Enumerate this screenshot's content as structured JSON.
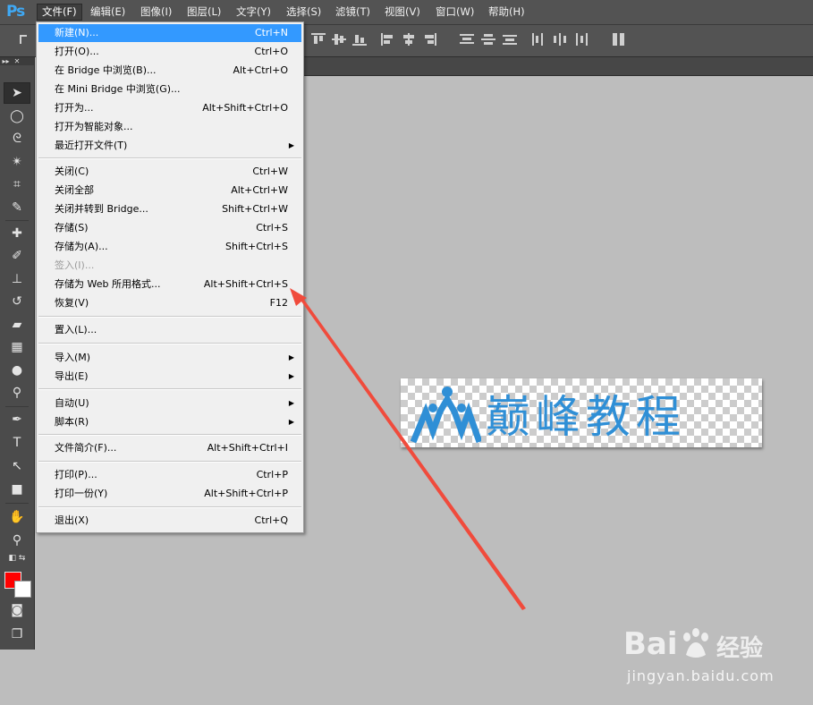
{
  "app": {
    "logo": "Ps"
  },
  "menubar": {
    "items": [
      {
        "label": "文件(F)"
      },
      {
        "label": "编辑(E)"
      },
      {
        "label": "图像(I)"
      },
      {
        "label": "图层(L)"
      },
      {
        "label": "文字(Y)"
      },
      {
        "label": "选择(S)"
      },
      {
        "label": "滤镜(T)"
      },
      {
        "label": "视图(V)"
      },
      {
        "label": "窗口(W)"
      },
      {
        "label": "帮助(H)"
      }
    ]
  },
  "file_menu": {
    "items": [
      {
        "label": "新建(N)...",
        "shortcut": "Ctrl+N"
      },
      {
        "label": "打开(O)...",
        "shortcut": "Ctrl+O"
      },
      {
        "label": "在 Bridge 中浏览(B)...",
        "shortcut": "Alt+Ctrl+O"
      },
      {
        "label": "在 Mini Bridge 中浏览(G)...",
        "shortcut": ""
      },
      {
        "label": "打开为...",
        "shortcut": "Alt+Shift+Ctrl+O"
      },
      {
        "label": "打开为智能对象...",
        "shortcut": ""
      },
      {
        "label": "最近打开文件(T)",
        "shortcut": ""
      },
      {
        "label": "关闭(C)",
        "shortcut": "Ctrl+W"
      },
      {
        "label": "关闭全部",
        "shortcut": "Alt+Ctrl+W"
      },
      {
        "label": "关闭并转到 Bridge...",
        "shortcut": "Shift+Ctrl+W"
      },
      {
        "label": "存储(S)",
        "shortcut": "Ctrl+S"
      },
      {
        "label": "存储为(A)...",
        "shortcut": "Shift+Ctrl+S"
      },
      {
        "label": "签入(I)...",
        "shortcut": ""
      },
      {
        "label": "存储为 Web 所用格式...",
        "shortcut": "Alt+Shift+Ctrl+S"
      },
      {
        "label": "恢复(V)",
        "shortcut": "F12"
      },
      {
        "label": "置入(L)...",
        "shortcut": ""
      },
      {
        "label": "导入(M)",
        "shortcut": ""
      },
      {
        "label": "导出(E)",
        "shortcut": ""
      },
      {
        "label": "自动(U)",
        "shortcut": ""
      },
      {
        "label": "脚本(R)",
        "shortcut": ""
      },
      {
        "label": "文件简介(F)...",
        "shortcut": "Alt+Shift+Ctrl+I"
      },
      {
        "label": "打印(P)...",
        "shortcut": "Ctrl+P"
      },
      {
        "label": "打印一份(Y)",
        "shortcut": "Alt+Shift+Ctrl+P"
      },
      {
        "label": "退出(X)",
        "shortcut": "Ctrl+Q"
      }
    ]
  },
  "canvas": {
    "image_text": "巅峰教程"
  },
  "watermark": {
    "brand": "Bai",
    "brand_suffix": "经验",
    "url": "jingyan.baidu.com"
  },
  "colors": {
    "menu_highlight": "#3399ff",
    "foreground": "#ff0000",
    "background": "#ffffff",
    "arrow": "#f04b3c",
    "logo_blue": "#2f8fd6"
  }
}
